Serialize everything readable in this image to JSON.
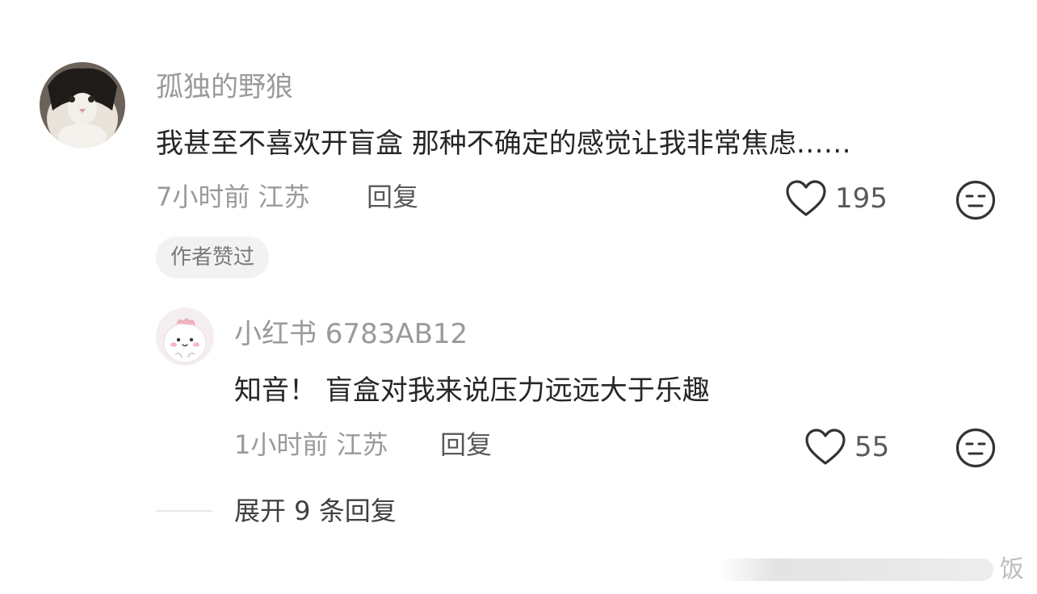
{
  "comment": {
    "username": "孤独的野狼",
    "text": "我甚至不喜欢开盲盒 那种不确定的感觉让我非常焦虑……",
    "time_location": "7小时前 江苏",
    "reply_label": "回复",
    "like_count": "195",
    "author_badge": "作者赞过"
  },
  "reply": {
    "username": "小红书 6783AB12",
    "text": "知音！ 盲盒对我来说压力远远大于乐趣",
    "time_location": "1小时前 江苏",
    "reply_label": "回复",
    "like_count": "55"
  },
  "expand_label": "展开 9 条回复",
  "watermark_text": "饭",
  "icons": {
    "like": "heart-outline-icon",
    "emoji": "neutral-face-icon"
  },
  "colors": {
    "text_primary": "#262626",
    "text_secondary": "#9a9a9a",
    "badge_bg": "#f2f2f2"
  }
}
